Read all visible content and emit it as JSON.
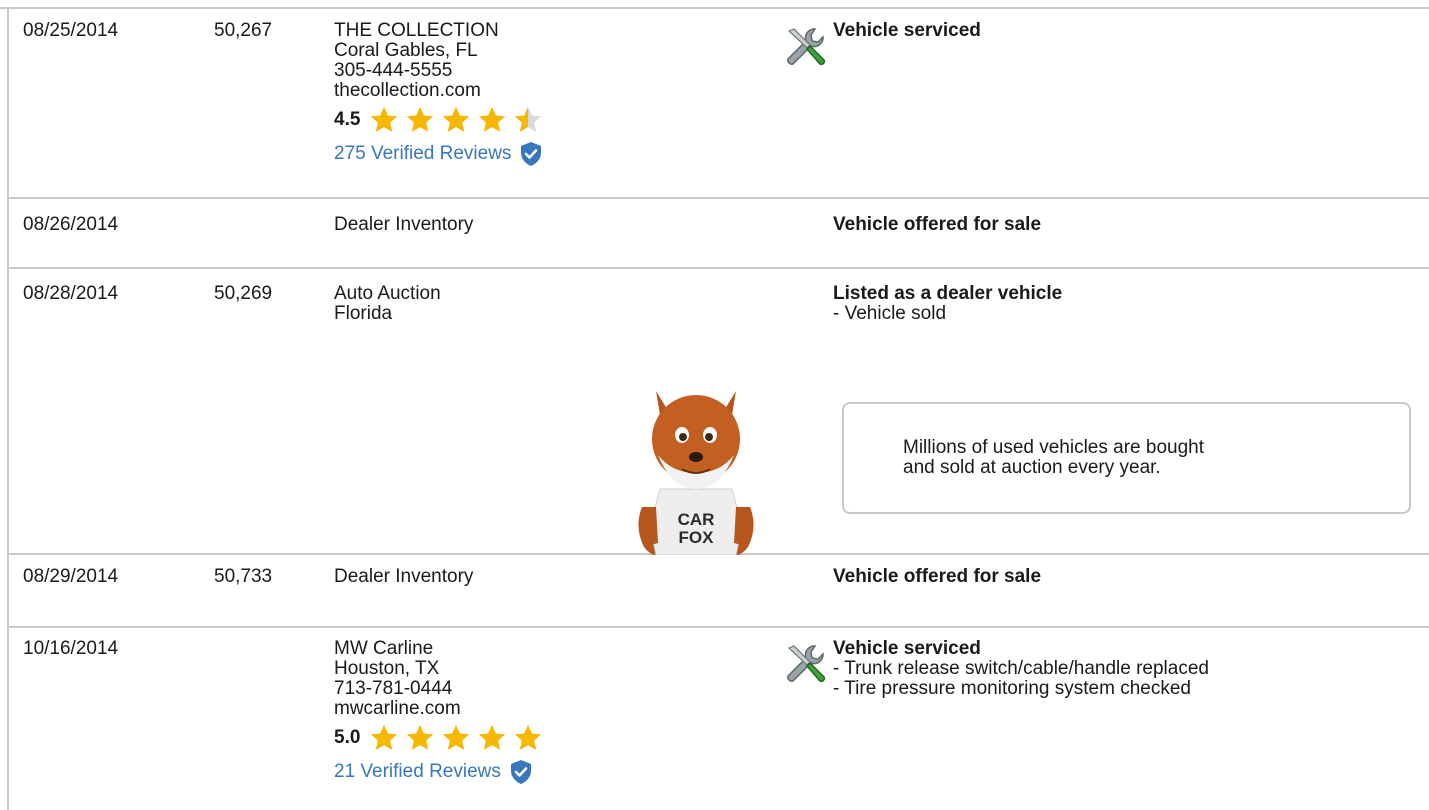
{
  "records": [
    {
      "date": "08/25/2014",
      "odometer": "50,267",
      "source": [
        "THE COLLECTION",
        "Coral Gables, FL",
        "305-444-5555",
        "thecollection.com"
      ],
      "rating": {
        "score": "4.5",
        "value": 4.5
      },
      "reviews": "275 Verified Reviews",
      "comments_head": "Vehicle serviced",
      "icon": "wrench-screwdriver-icon"
    },
    {
      "date": "08/26/2014",
      "odometer": "",
      "source": [
        "Dealer Inventory"
      ],
      "comments_head": "Vehicle offered for sale"
    },
    {
      "date": "08/28/2014",
      "odometer": "50,269",
      "source": [
        "Auto Auction",
        "Florida"
      ],
      "comments_head": "Listed as a dealer vehicle",
      "comments": [
        "- Vehicle sold"
      ]
    },
    {
      "date": "08/29/2014",
      "odometer": "50,733",
      "source": [
        "Dealer Inventory"
      ],
      "comments_head": "Vehicle offered for sale"
    },
    {
      "date": "10/16/2014",
      "odometer": "",
      "source": [
        "MW Carline",
        "Houston, TX",
        "713-781-0444",
        "mwcarline.com"
      ],
      "rating": {
        "score": "5.0",
        "value": 5.0
      },
      "reviews": "21 Verified Reviews",
      "comments_head": "Vehicle serviced",
      "comments": [
        "- Trunk release switch/cable/handle replaced",
        "- Tire pressure monitoring system checked"
      ],
      "icon": "wrench-screwdriver-icon"
    }
  ],
  "mascot": {
    "shirt_line1": "CAR",
    "shirt_line2": "FOX"
  },
  "callout": {
    "text": [
      "Millions of used vehicles are bought",
      "and sold at auction every year."
    ]
  },
  "colors": {
    "star": "#f5b700",
    "link": "#3777bc",
    "border": "#c8c8c8"
  }
}
